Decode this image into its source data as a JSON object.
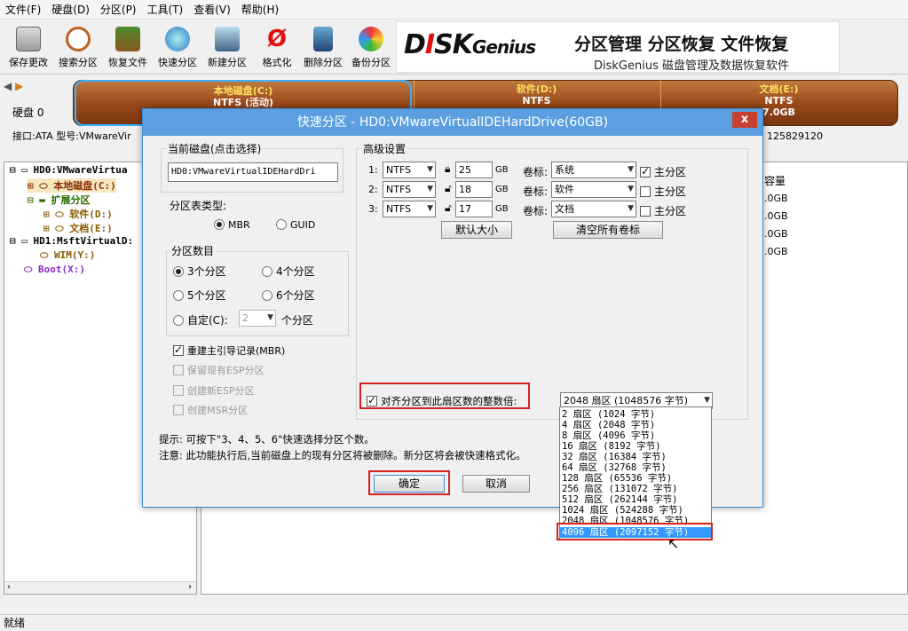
{
  "menu": [
    "文件(F)",
    "硬盘(D)",
    "分区(P)",
    "工具(T)",
    "查看(V)",
    "帮助(H)"
  ],
  "toolbar": [
    {
      "label": "保存更改",
      "icon": "save-icon"
    },
    {
      "label": "搜索分区",
      "icon": "magnifier-icon"
    },
    {
      "label": "恢复文件",
      "icon": "recover-icon"
    },
    {
      "label": "快速分区",
      "icon": "quick-partition-icon"
    },
    {
      "label": "新建分区",
      "icon": "new-partition-icon"
    },
    {
      "label": "格式化",
      "icon": "format-icon"
    },
    {
      "label": "删除分区",
      "icon": "trash-icon"
    },
    {
      "label": "备份分区",
      "icon": "backup-icon"
    }
  ],
  "banner": {
    "logo_part1": "D",
    "logo_part2": "I",
    "logo_part3": "SK",
    "logo_part4": "Genius",
    "headline": "分区管理 分区恢复 文件恢复",
    "subline": "DiskGenius 磁盘管理及数据恢复软件"
  },
  "disk_label": "硬盘 0",
  "partitions": [
    {
      "name": "本地磁盘(C:)",
      "fs": "NTFS (活动)",
      "size": ""
    },
    {
      "name": "软件(D:)",
      "fs": "NTFS",
      "size": ""
    },
    {
      "name": "文档(E:)",
      "fs": "NTFS",
      "size": "7.0GB"
    }
  ],
  "infoline": {
    "left": "接口:ATA  型号:VMwareVir",
    "right": "125829120"
  },
  "tree": [
    {
      "text": "HD0:VMwareVirtua",
      "color": "#000"
    },
    {
      "text": "本地磁盘(C:)",
      "color": "#8a3000"
    },
    {
      "text": "扩展分区",
      "color": "#2a6a00"
    },
    {
      "text": "软件(D:)",
      "color": "#8a5a00"
    },
    {
      "text": "文档(E:)",
      "color": "#8a5a00"
    },
    {
      "text": "HD1:MsftVirtualD:",
      "color": "#000"
    },
    {
      "text": "WIM(Y:)",
      "color": "#8a5a00"
    },
    {
      "text": "Boot(X:)",
      "color": "#8a2ac8"
    }
  ],
  "right_col": {
    "header": "容量",
    "values": [
      ".0GB",
      ".0GB",
      ".0GB",
      ".0GB"
    ]
  },
  "status": "就绪",
  "dialog": {
    "title": "快速分区 - HD0:VMwareVirtualIDEHardDrive(60GB)",
    "close": "x",
    "current_disk_title": "当前磁盘(点击选择)",
    "current_disk_value": "HD0:VMwareVirtualIDEHardDri",
    "table_type_title": "分区表类型:",
    "mbr": "MBR",
    "guid": "GUID",
    "count_title": "分区数目",
    "count_options": [
      "3个分区",
      "4个分区",
      "5个分区",
      "6个分区"
    ],
    "custom_label": "自定(C):",
    "custom_value": "2",
    "custom_suffix": "个分区",
    "rebuild_mbr": "重建主引导记录(MBR)",
    "keep_esp": "保留现有ESP分区",
    "new_esp": "创建新ESP分区",
    "new_msr": "创建MSR分区",
    "advanced_title": "高级设置",
    "rows": [
      {
        "num": "1:",
        "fs": "NTFS",
        "size": "25",
        "unit": "GB",
        "vol_label": "卷标:",
        "vol": "系统",
        "primary": "主分区",
        "primary_checked": true
      },
      {
        "num": "2:",
        "fs": "NTFS",
        "size": "18",
        "unit": "GB",
        "vol_label": "卷标:",
        "vol": "软件",
        "primary": "主分区",
        "primary_checked": false
      },
      {
        "num": "3:",
        "fs": "NTFS",
        "size": "17",
        "unit": "GB",
        "vol_label": "卷标:",
        "vol": "文档",
        "primary": "主分区",
        "primary_checked": false
      }
    ],
    "default_size_btn": "默认大小",
    "clear_labels_btn": "清空所有卷标",
    "align_label": "对齐分区到此扇区数的整数倍:",
    "align_selected": "2048 扇区 (1048576 字节)",
    "align_options": [
      "2 扇区 (1024 字节)",
      "4 扇区 (2048 字节)",
      "8 扇区 (4096 字节)",
      "16 扇区 (8192 字节)",
      "32 扇区 (16384 字节)",
      "64 扇区 (32768 字节)",
      "128 扇区 (65536 字节)",
      "256 扇区 (131072 字节)",
      "512 扇区 (262144 字节)",
      "1024 扇区 (524288 字节)",
      "2048 扇区 (1048576 字节)",
      "4096 扇区 (2097152 字节)"
    ],
    "tip1": "提示: 可按下\"3、4、5、6\"快速选择分区个数。",
    "tip2": "注意: 此功能执行后,当前磁盘上的现有分区将被删除。新分区将会被快速格式化。",
    "ok": "确定",
    "cancel": "取消"
  },
  "colors": {
    "title_bar": "#5b9fe0",
    "highlight": "#3399ff",
    "red_box": "#d42020",
    "disk_bar": "#9a4a1a"
  }
}
